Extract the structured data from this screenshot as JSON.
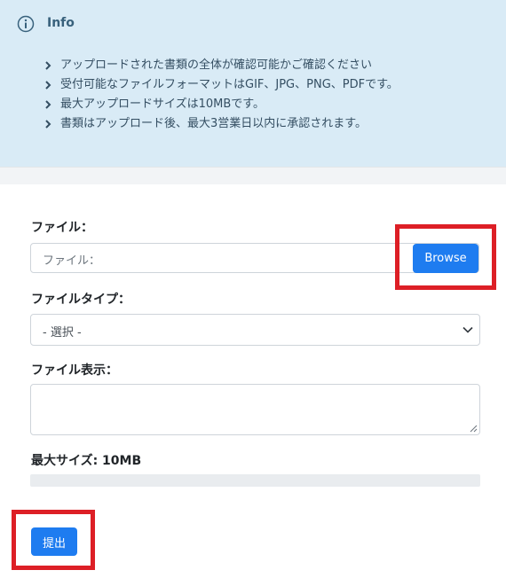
{
  "info": {
    "icon": "info-circle-icon",
    "title": "Info",
    "items": [
      "アップロードされた書類の全体が確認可能かご確認ください",
      "受付可能なファイルフォーマットはGIF、JPG、PNG、PDFです。",
      "最大アップロードサイズは10MBです。",
      "書類はアップロード後、最大3営業日以内に承認されます。"
    ]
  },
  "form": {
    "file_label": "ファイル：",
    "file_placeholder": "ファイル：",
    "browse_label": "Browse",
    "file_type_label": "ファイルタイプ：",
    "file_type_selected": "- 選択 -",
    "file_display_label": "ファイル表示：",
    "max_size_label": "最大サイズ: 10MB",
    "upload_progress": 0,
    "submit_label": "提出"
  },
  "colors": {
    "info_bg": "#d9ebf6",
    "primary": "#1e7cf0",
    "highlight": "#dd1f26"
  }
}
